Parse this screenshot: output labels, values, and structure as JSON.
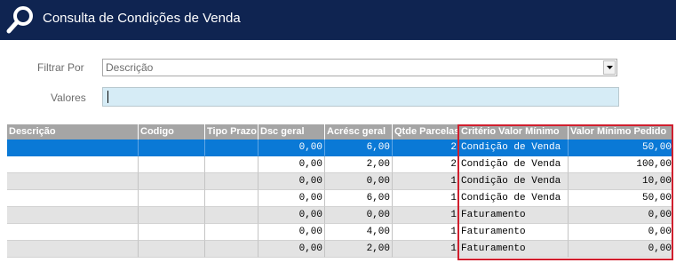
{
  "window": {
    "title": "Consulta de Condições de Venda",
    "icon": "magnifier-icon"
  },
  "filter": {
    "label": "Filtrar Por",
    "selected": "Descrição",
    "values_label": "Valores",
    "values_value": ""
  },
  "grid": {
    "columns": [
      "Descrição",
      "Codigo",
      "Tipo Prazo",
      "Dsc geral",
      "Acrésc geral",
      "Qtde Parcelas",
      "Critério Valor Mínimo",
      "Valor Mínimo Pedido"
    ],
    "rows": [
      {
        "descricao": "",
        "codigo": "",
        "tipo_prazo": "",
        "dsc_geral": "0,00",
        "acresc_geral": "6,00",
        "parcelas": "2",
        "criterio": "Condição de Venda",
        "valor_minimo": "50,00"
      },
      {
        "descricao": "",
        "codigo": "",
        "tipo_prazo": "",
        "dsc_geral": "0,00",
        "acresc_geral": "2,00",
        "parcelas": "2",
        "criterio": "Condição de Venda",
        "valor_minimo": "100,00"
      },
      {
        "descricao": "",
        "codigo": "",
        "tipo_prazo": "",
        "dsc_geral": "0,00",
        "acresc_geral": "0,00",
        "parcelas": "1",
        "criterio": "Condição de Venda",
        "valor_minimo": "10,00"
      },
      {
        "descricao": "",
        "codigo": "",
        "tipo_prazo": "",
        "dsc_geral": "0,00",
        "acresc_geral": "6,00",
        "parcelas": "1",
        "criterio": "Condição de Venda",
        "valor_minimo": "50,00"
      },
      {
        "descricao": "",
        "codigo": "",
        "tipo_prazo": "",
        "dsc_geral": "0,00",
        "acresc_geral": "0,00",
        "parcelas": "1",
        "criterio": "Faturamento",
        "valor_minimo": "0,00"
      },
      {
        "descricao": "",
        "codigo": "",
        "tipo_prazo": "",
        "dsc_geral": "0,00",
        "acresc_geral": "4,00",
        "parcelas": "1",
        "criterio": "Faturamento",
        "valor_minimo": "0,00"
      },
      {
        "descricao": "",
        "codigo": "",
        "tipo_prazo": "",
        "dsc_geral": "0,00",
        "acresc_geral": "2,00",
        "parcelas": "1",
        "criterio": "Faturamento",
        "valor_minimo": "0,00"
      }
    ]
  },
  "colors": {
    "titlebar": "#0f2451",
    "header": "#a5a5a5",
    "selected_row": "#0a79d6",
    "highlight_border": "#d01f2e",
    "input_bg": "#d6ecf6"
  }
}
